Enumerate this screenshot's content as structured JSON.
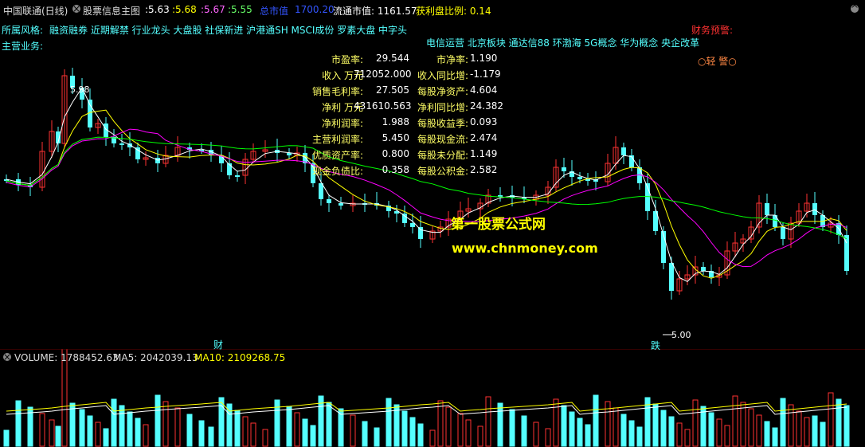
{
  "header": {
    "title": "中国联通(日线)",
    "indicator_name": "股票信息主图",
    "values": [
      ":5.63",
      ":5.68",
      ":5.67",
      ":5.55"
    ],
    "total_mv_label": "总市值",
    "total_mv_value": "1700.20",
    "float_mv": "流通市值: 1161.57",
    "profit_ratio": "获利盘比例: 0.14"
  },
  "tags": {
    "style_label": "所属风格:",
    "style_items": "融资融券 近期解禁 行业龙头 大盘股 社保新进 沪港通SH MSCI成份 罗素大盘 中字头",
    "business_label": "主营业务:",
    "concepts": "电信运营 北京板块 通达信88 环渤海 5G概念 华为概念 央企改革",
    "warning_label": "财务预警:",
    "warning_level": "○轻 警○"
  },
  "finance": {
    "left": [
      {
        "label": "市盈率:",
        "value": "29.544"
      },
      {
        "label": "收入 万元",
        "value": "712052.000"
      },
      {
        "label": "销售毛利率:",
        "value": "27.505"
      },
      {
        "label": "净利 万元",
        "value": "431610.563"
      },
      {
        "label": "净利润率:",
        "value": "1.988"
      },
      {
        "label": "主营利润率:",
        "value": "5.450"
      },
      {
        "label": "优质资产率:",
        "value": "0.800"
      },
      {
        "label": "现金负债比:",
        "value": "0.358"
      }
    ],
    "right": [
      {
        "label": "市净率:",
        "value": "1.190"
      },
      {
        "label": "收入同比增:",
        "value": "-1.179"
      },
      {
        "label": "每股净资产:",
        "value": "4.604"
      },
      {
        "label": "净利同比增:",
        "value": "24.382"
      },
      {
        "label": "每股收益季:",
        "value": "0.093"
      },
      {
        "label": "每股现金流:",
        "value": "2.474"
      },
      {
        "label": "每股未分配:",
        "value": "1.149"
      },
      {
        "label": "每股公积金:",
        "value": "2.582"
      }
    ]
  },
  "markers": {
    "high_price": "5.98",
    "low_price": "5.00",
    "cai_mark": "财",
    "die_mark": "跌"
  },
  "watermark": {
    "line1": "第一股票公式网",
    "line2": "www.chnmoney.com"
  },
  "volume": {
    "label": "VOLUME: 1788452.63",
    "ma5": "MA5: 2042039.13",
    "ma10": "MA10: 2109268.75"
  },
  "colors": {
    "up": "#ff3232",
    "down": "#54ffff",
    "ma_white": "#ffffff",
    "ma_yellow": "#ffff00",
    "ma_magenta": "#ff00ff",
    "ma_green": "#00ff00"
  }
}
